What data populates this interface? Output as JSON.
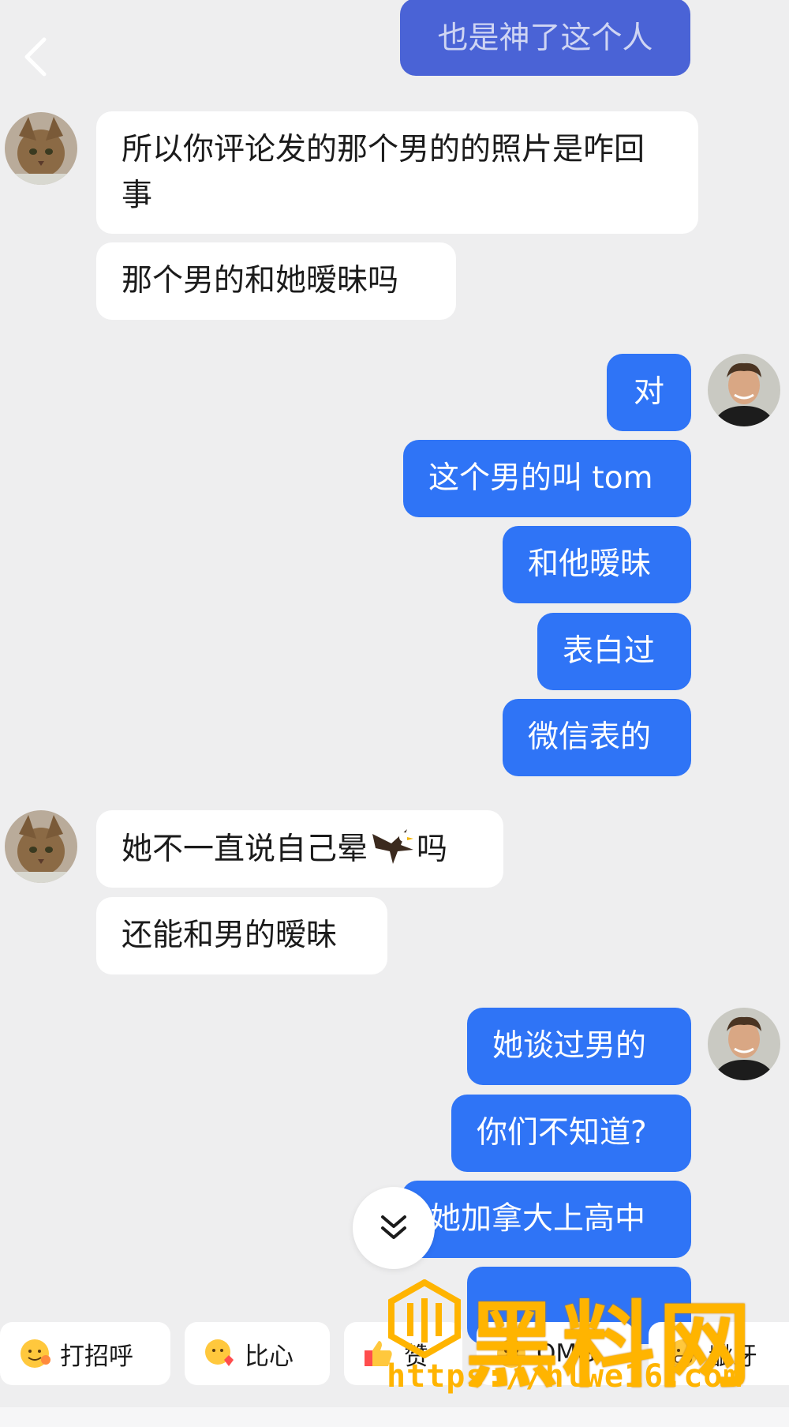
{
  "colors": {
    "background": "#eeeeef",
    "outgoing": "#2f74f6",
    "incoming": "#ffffff"
  },
  "header": {
    "back_icon": "chevron-left-icon"
  },
  "messages": [
    {
      "side": "out",
      "text": "也是神了这个人"
    },
    {
      "side": "in",
      "text": "所以你评论发的那个男的的照片是咋回事"
    },
    {
      "side": "in",
      "text": "那个男的和她暧昧吗"
    },
    {
      "side": "out",
      "text": "对"
    },
    {
      "side": "out",
      "text": "这个男的叫 tom"
    },
    {
      "side": "out",
      "text": "和他暧昧"
    },
    {
      "side": "out",
      "text": "表白过"
    },
    {
      "side": "out",
      "text": "微信表的"
    },
    {
      "side": "in",
      "text_before": "她不一直说自己晕",
      "icon": "eagle-icon",
      "text_after": "吗"
    },
    {
      "side": "in",
      "text": "还能和男的暧昧"
    },
    {
      "side": "out",
      "text": "她谈过男的"
    },
    {
      "side": "out",
      "text": "你们不知道?"
    },
    {
      "side": "out",
      "text": "她加拿大上高中"
    },
    {
      "side": "out",
      "text": ""
    }
  ],
  "quick_replies": [
    {
      "label": "打招呼",
      "icon": "wave-emoji-icon"
    },
    {
      "label": "比心",
      "icon": "heart-hands-emoji-icon"
    },
    {
      "label": "赞",
      "icon": "thumbs-up-emoji-icon"
    },
    {
      "label": "OMG",
      "icon": "omg-emoji-icon"
    },
    {
      "label": "龇牙",
      "icon": "grin-emoji-icon"
    }
  ],
  "watermark": {
    "title": "黑料网",
    "url": "https://hlwe16.com"
  }
}
